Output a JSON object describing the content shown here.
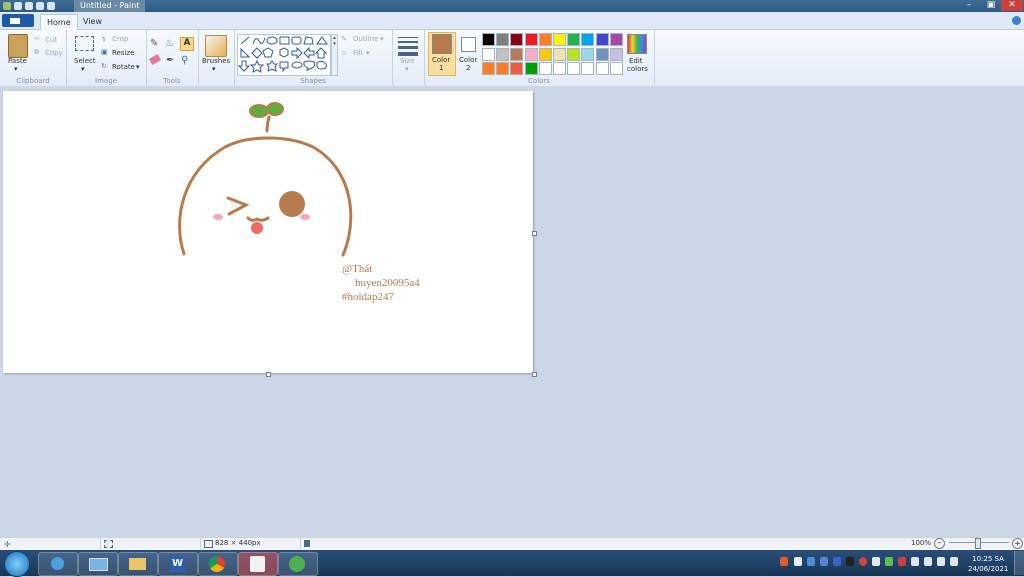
{
  "window": {
    "title": "Untitled - Paint"
  },
  "tabs": [
    {
      "label": "Home"
    },
    {
      "label": "View"
    }
  ],
  "ribbon": {
    "clipboard": {
      "label": "Clipboard",
      "paste": "Paste",
      "cut": "Cut",
      "copy": "Copy"
    },
    "image": {
      "label": "Image",
      "select": "Select",
      "crop": "Crop",
      "resize": "Resize",
      "rotate": "Rotate"
    },
    "tools": {
      "label": "Tools"
    },
    "brushes": {
      "label": "Brushes"
    },
    "shapes": {
      "label": "Shapes",
      "outline": "Outline",
      "fill": "Fill"
    },
    "size": {
      "label": "Size"
    },
    "colors": {
      "label": "Colors",
      "color1": "Color",
      "color1_num": "1",
      "color2": "Color",
      "color2_num": "2",
      "edit": "Edit",
      "edit2": "colors",
      "primary": "#b57b4d",
      "secondary": "#ffffff",
      "palette": [
        "#000000",
        "#7f7f7f",
        "#880015",
        "#ed1c24",
        "#ff7f27",
        "#fff200",
        "#22b14c",
        "#00a2e8",
        "#3f48cc",
        "#a349a4",
        "#ffffff",
        "#c3c3c3",
        "#b97a57",
        "#ffaec9",
        "#ffc90e",
        "#efe4b0",
        "#b5e61d",
        "#99d9ea",
        "#7092be",
        "#c8bfe7",
        "#ff7f27",
        "#ff7f27",
        "#f05a3c",
        "#00a000",
        "#ffffff",
        "#ffffff",
        "#ffffff",
        "#ffffff",
        "#ffffff",
        "#ffffff"
      ]
    }
  },
  "canvas": {
    "line1": "@Thất",
    "line2": "huyen20095a4",
    "line3": "#hoidap247",
    "ink": "#b57b4d"
  },
  "status": {
    "dimensions": "828 × 440px",
    "zoom": "100%"
  },
  "taskbar": {
    "time": "10:25 SA",
    "date": "24/06/2021"
  }
}
